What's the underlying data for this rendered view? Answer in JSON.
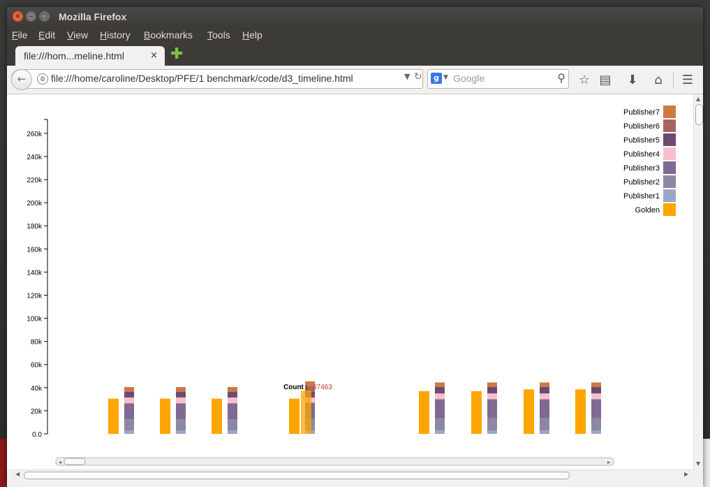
{
  "window": {
    "title": "Mozilla Firefox"
  },
  "menu": [
    {
      "label": "File",
      "accel": "F",
      "rest": "ile"
    },
    {
      "label": "Edit",
      "accel": "E",
      "rest": "dit"
    },
    {
      "label": "View",
      "accel": "V",
      "rest": "iew"
    },
    {
      "label": "History",
      "accel": "H",
      "rest": "istory"
    },
    {
      "label": "Bookmarks",
      "accel": "B",
      "rest": "ookmarks"
    },
    {
      "label": "Tools",
      "accel": "T",
      "rest": "ools"
    },
    {
      "label": "Help",
      "accel": "H",
      "rest": "elp"
    }
  ],
  "tab": {
    "title": "file:///hom...meline.html",
    "close": "×"
  },
  "address": {
    "url": "file:///home/caroline/Desktop/PFE/1 benchmark/code/d3_timeline.html"
  },
  "search": {
    "placeholder": "Google",
    "engine_badge": "g"
  },
  "icons": {
    "back": "back-arrow-icon",
    "globe": "globe-icon",
    "reload": "reload-icon",
    "search": "magnifier-icon",
    "bookmark": "star-icon",
    "reading": "clipboard-icon",
    "downloads": "download-arrow-icon",
    "home": "home-icon",
    "menu": "hamburger-menu-icon"
  },
  "chart_data": {
    "type": "bar",
    "yticks": [
      "260k",
      "240k",
      "220k",
      "200k",
      "180k",
      "160k",
      "140k",
      "120k",
      "100k",
      "80k",
      "60k",
      "40k",
      "20k",
      "0.0"
    ],
    "ytick_values": [
      260000,
      240000,
      220000,
      200000,
      180000,
      160000,
      140000,
      120000,
      100000,
      80000,
      60000,
      40000,
      20000,
      0
    ],
    "ylim": [
      0,
      272000
    ],
    "legend": [
      {
        "name": "Publisher7",
        "color": "#cb7a45"
      },
      {
        "name": "Publisher6",
        "color": "#a8655f"
      },
      {
        "name": "Publisher5",
        "color": "#6e4a72"
      },
      {
        "name": "Publisher4",
        "color": "#f7bfcc"
      },
      {
        "name": "Publisher3",
        "color": "#7e6a92"
      },
      {
        "name": "Publisher2",
        "color": "#8d87a4"
      },
      {
        "name": "Publisher1",
        "color": "#99a7c8"
      },
      {
        "name": "Golden",
        "color": "#ffa500"
      }
    ],
    "groups": [
      {
        "golden": 30500,
        "stack": [
          3000,
          9500,
          14000,
          5000,
          5000,
          0,
          4000
        ]
      },
      {
        "golden": 30500,
        "stack": [
          3000,
          9500,
          14000,
          5000,
          5000,
          0,
          4000
        ]
      },
      {
        "golden": 30500,
        "stack": [
          3000,
          9500,
          14000,
          5000,
          5000,
          0,
          4000
        ]
      },
      {
        "golden": 30500,
        "stack": [
          3000,
          10000,
          14000,
          4500,
          5000,
          5000,
          4000
        ],
        "hover_golden": 37463
      },
      {
        "golden": 37000,
        "stack": [
          3000,
          10500,
          16500,
          5000,
          5500,
          0,
          4000
        ]
      },
      {
        "golden": 37000,
        "stack": [
          3000,
          10500,
          16500,
          5000,
          5500,
          0,
          4000
        ]
      },
      {
        "golden": 38500,
        "stack": [
          3000,
          10500,
          16500,
          5000,
          5500,
          0,
          4000
        ]
      },
      {
        "golden": 38500,
        "stack": [
          3000,
          10500,
          16500,
          5000,
          5500,
          0,
          4000
        ]
      }
    ],
    "tooltip": {
      "label": "Count :",
      "value": "37463"
    }
  }
}
